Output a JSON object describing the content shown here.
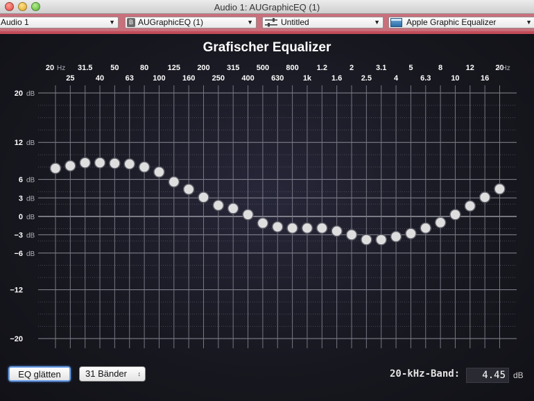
{
  "window": {
    "title": "Audio 1: AUGraphicEQ (1)"
  },
  "toolbar": {
    "track_select": "Audio 1",
    "plugin_badge": "B",
    "plugin_select": "AUGraphicEQ (1)",
    "preset_select": "Untitled",
    "view_select": "Apple Graphic Equalizer"
  },
  "eq": {
    "title": "Grafischer Equalizer",
    "freq_labels_top": [
      "20",
      "31.5",
      "50",
      "80",
      "125",
      "200",
      "315",
      "500",
      "800",
      "1.2",
      "2",
      "3.1",
      "5",
      "8",
      "12",
      "20"
    ],
    "freq_labels_bottom": [
      "25",
      "40",
      "63",
      "100",
      "160",
      "250",
      "400",
      "630",
      "1k",
      "1.6",
      "2.5",
      "4",
      "6.3",
      "10",
      "16"
    ],
    "unit_hz": "Hz",
    "unit_khz": "kHz",
    "db_unit": "dB",
    "y_labels": [
      {
        "value": 20,
        "text": "20",
        "unit": true
      },
      {
        "value": 12,
        "text": "12",
        "unit": true
      },
      {
        "value": 6,
        "text": "6",
        "unit": true
      },
      {
        "value": 3,
        "text": "3",
        "unit": true
      },
      {
        "value": 0,
        "text": "0",
        "unit": true
      },
      {
        "value": -3,
        "text": "−3",
        "unit": true
      },
      {
        "value": -6,
        "text": "−6",
        "unit": true
      },
      {
        "value": -12,
        "text": "−12",
        "unit": false
      },
      {
        "value": -20,
        "text": "−20",
        "unit": false
      }
    ],
    "ylim": [
      -20,
      20
    ],
    "band_gains": [
      7.8,
      8.2,
      8.7,
      8.7,
      8.6,
      8.5,
      8.0,
      7.2,
      5.6,
      4.4,
      3.1,
      1.8,
      1.3,
      0.3,
      -1.1,
      -1.7,
      -1.9,
      -1.9,
      -1.9,
      -2.4,
      -3.0,
      -3.8,
      -3.8,
      -3.3,
      -2.8,
      -1.9,
      -1.0,
      0.3,
      1.7,
      3.1,
      4.45
    ],
    "colors": {
      "grid": "#8a8a96",
      "zero_line": "#d6d6dc",
      "knob": "#dedede",
      "label": "#ffffff"
    }
  },
  "controls": {
    "smooth_button": "EQ glätten",
    "bands_select": "31 Bänder",
    "selected_band_label": "20-kHz-Band:",
    "selected_band_value": "4.45",
    "selected_band_unit": "dB"
  }
}
